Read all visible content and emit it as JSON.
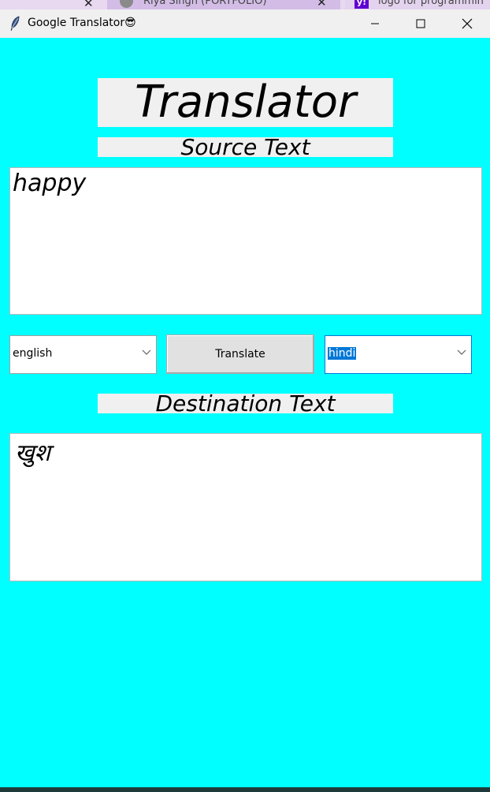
{
  "browser_tabs": [
    {
      "title": "Riya Singh (PORTFOLIO)",
      "icon": "globe-icon"
    },
    {
      "title": "logo for programmin",
      "icon": "yahoo-icon"
    }
  ],
  "window": {
    "title": "Google Translator😎",
    "icon": "feather-icon"
  },
  "app": {
    "heading": "Translator",
    "source_label": "Source Text",
    "source_text": "happy",
    "source_language": "english",
    "translate_label": "Translate",
    "destination_language": "hindi",
    "destination_label": "Destination Text",
    "destination_text": "खुश"
  },
  "colors": {
    "background": "#00ffff",
    "label_bg": "#f0f0f0",
    "selection": "#0078d7"
  }
}
